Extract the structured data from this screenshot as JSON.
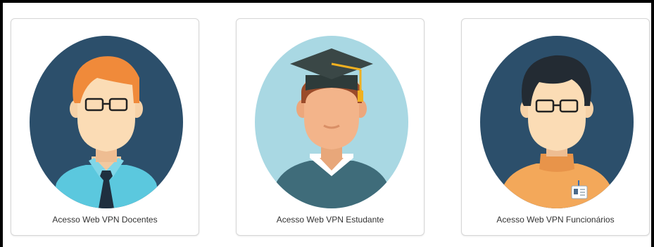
{
  "cards": [
    {
      "label": "Acesso Web VPN Docentes",
      "avatar": "teacher-avatar-icon",
      "bg_color": "#2c4f6b"
    },
    {
      "label": "Acesso Web VPN Estudante",
      "avatar": "student-graduate-avatar-icon",
      "bg_color": "#a9d8e3"
    },
    {
      "label": "Acesso Web VPN Funcionários",
      "avatar": "staff-avatar-icon",
      "bg_color": "#2c4f6b"
    }
  ]
}
